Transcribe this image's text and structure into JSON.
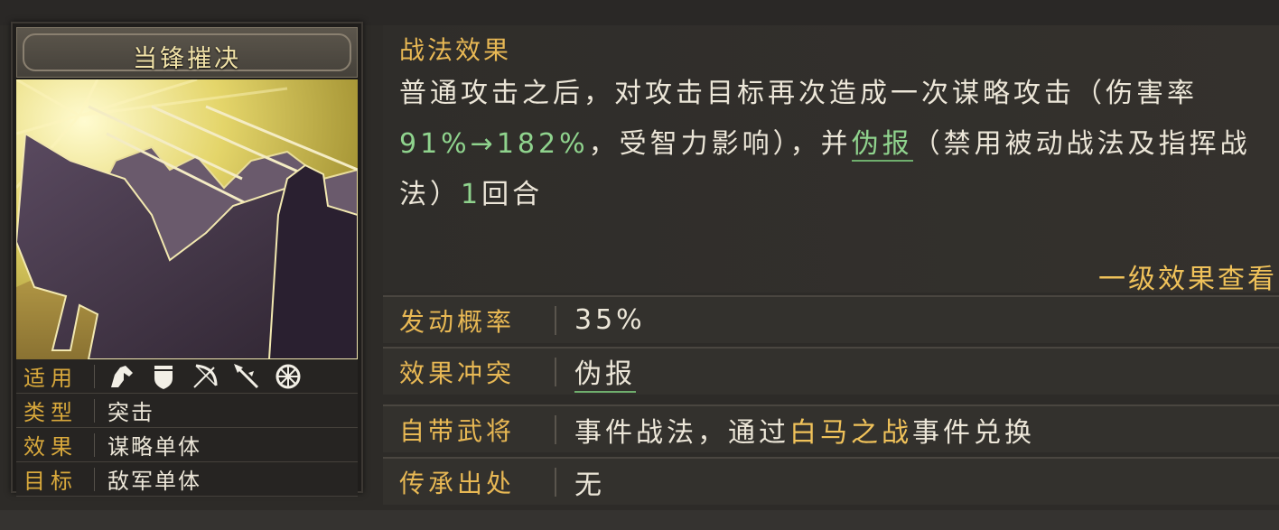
{
  "skill": {
    "name": "当锋摧决"
  },
  "props": [
    {
      "label": "适用",
      "value": ""
    },
    {
      "label": "类型",
      "value": "突击"
    },
    {
      "label": "效果",
      "value": "谋略单体"
    },
    {
      "label": "目标",
      "value": "敌军单体"
    }
  ],
  "troop_icons": [
    "cavalry-icon",
    "shield-icon",
    "bow-icon",
    "spear-icon",
    "siege-icon"
  ],
  "effect": {
    "title": "战法效果",
    "text_1": "普通攻击之后，对攻击目标再次造成一次谋略攻击（伤害率",
    "rate": "91%→182%",
    "text_2": "，受智力影响），并",
    "status": "伪报",
    "text_3": "（禁用被动战法及指挥战法）",
    "rounds": "1",
    "text_4": "回合",
    "view_link": "一级效果查看"
  },
  "rows": [
    {
      "label": "发动概率",
      "value": "35%"
    },
    {
      "label": "效果冲突",
      "value": "伪报"
    },
    {
      "label": "自带武将",
      "value_1": "事件战法，通过",
      "event": "白马之战",
      "value_2": "事件兑换"
    },
    {
      "label": "传承出处",
      "value": "无"
    }
  ],
  "colors": {
    "label": "#e8b854",
    "highlight_green": "#8fd38d",
    "highlight_gold": "#f0c25a",
    "text": "#ece6d8"
  }
}
